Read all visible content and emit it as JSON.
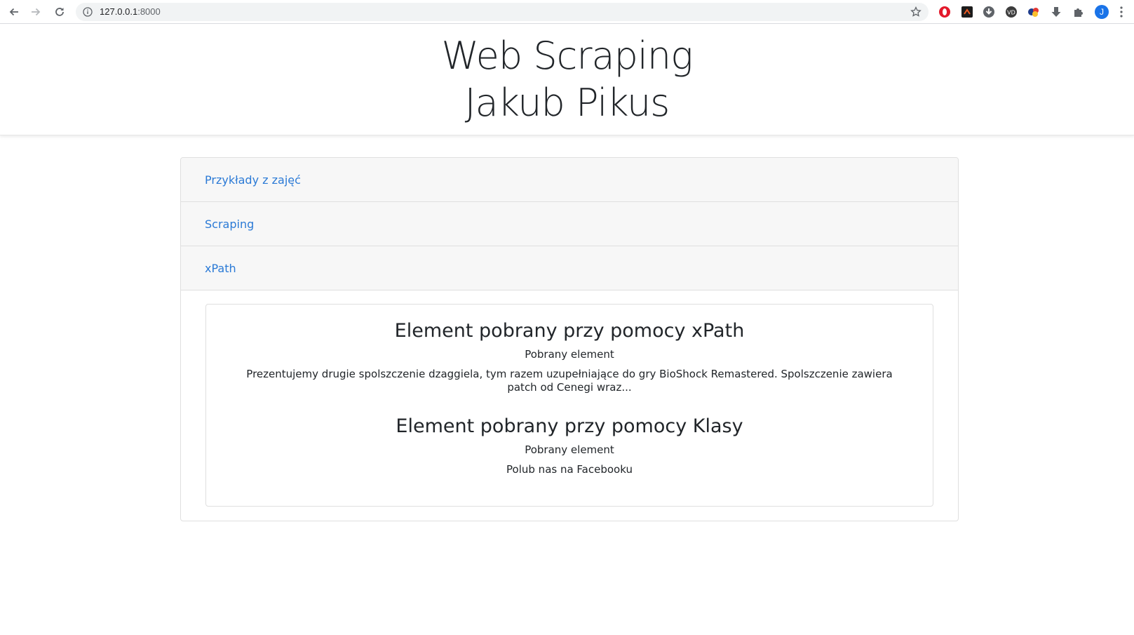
{
  "browser": {
    "url_host": "127.0.0.1",
    "url_port": ":8000",
    "profile_initial": "J",
    "extensions": [
      "opera-icon",
      "brave-ext-icon",
      "download-circle-icon",
      "vd-icon",
      "colors-ext-icon",
      "download-arrow-icon",
      "puzzle-icon"
    ]
  },
  "header": {
    "title_line1": "Web Scraping",
    "title_line2": "Jakub Pikus"
  },
  "accordion": {
    "items": [
      {
        "label": "Przykłady z zajęć"
      },
      {
        "label": "Scraping"
      },
      {
        "label": "xPath"
      }
    ]
  },
  "card": {
    "section1": {
      "heading": "Element pobrany przy pomocy xPath",
      "label": "Pobrany element",
      "text": "Prezentujemy drugie spolszczenie dzaggiela, tym razem uzupełniające do gry BioShock Remastered. Spolszczenie zawiera patch od Cenegi wraz..."
    },
    "section2": {
      "heading": "Element pobrany przy pomocy Klasy",
      "label": "Pobrany element",
      "text": "Polub nas na Facebooku"
    }
  },
  "colors": {
    "link": "#2b7ad6",
    "accordion_bg": "#f7f7f7",
    "text": "#212529"
  }
}
